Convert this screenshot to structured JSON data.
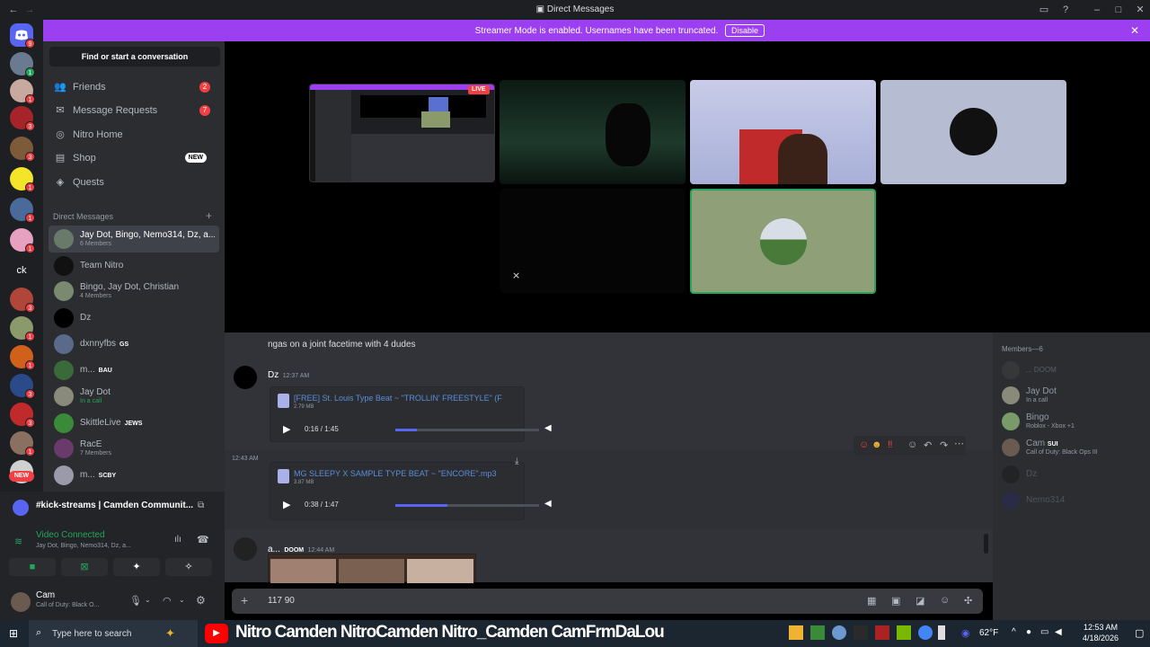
{
  "titlebar": {
    "title": "Direct Messages"
  },
  "banner": {
    "text": "Streamer Mode is enabled. Usernames have been truncated.",
    "button": "Disable"
  },
  "guild_badges": [
    "9",
    "1",
    "1",
    "3",
    "3",
    "1",
    "1",
    "1",
    "3",
    "1",
    "1",
    "3",
    "3",
    "1"
  ],
  "guild_text": {
    "ck": "ck",
    "new": "NEW"
  },
  "sidebar": {
    "search": "Find or start a conversation",
    "nav": [
      {
        "label": "Friends",
        "badge": "2"
      },
      {
        "label": "Message Requests",
        "badge": "7"
      },
      {
        "label": "Nitro Home",
        "badge": ""
      },
      {
        "label": "Shop",
        "badge": "NEW"
      },
      {
        "label": "Quests",
        "badge": ""
      }
    ],
    "dm_header": "Direct Messages",
    "dms": [
      {
        "name": "Jay Dot, Bingo, Nemo314, Dz, a...",
        "sub": "6 Members",
        "tag": ""
      },
      {
        "name": "Team Nitro",
        "sub": "",
        "tag": ""
      },
      {
        "name": "Bingo, Jay Dot, Christian",
        "sub": "4 Members",
        "tag": ""
      },
      {
        "name": "Dz",
        "sub": "",
        "tag": ""
      },
      {
        "name": "dxnnyfbs",
        "sub": "",
        "tag": "GS"
      },
      {
        "name": "m...",
        "sub": "",
        "tag": "BAU"
      },
      {
        "name": "Jay Dot",
        "sub": "In a call",
        "tag": ""
      },
      {
        "name": "SkittleLive",
        "sub": "",
        "tag": "JEWS"
      },
      {
        "name": "RacE",
        "sub": "7 Members",
        "tag": ""
      },
      {
        "name": "m...",
        "sub": "",
        "tag": "SCBY"
      }
    ]
  },
  "voice": {
    "channel": "#kick-streams | Camden Communit...",
    "status": "Video Connected",
    "members": "Jay Dot, Bingo, Nemo314, Dz, a..."
  },
  "user": {
    "name": "Cam",
    "activity": "Call of Duty: Black O..."
  },
  "stage": {
    "live": "LIVE"
  },
  "chat": {
    "partial_msg": "ngas on a joint facetime with 4 dudes",
    "msg1": {
      "author": "Dz",
      "time": "12:37 AM",
      "file": "[FREE] St. Louis Type Beat ~ \"TROLLIN' FREESTYLE\" (F",
      "size": "2.79 MB",
      "progress": "0:16 / 1:45",
      "fraction": 0.15
    },
    "msg2": {
      "time": "12:43 AM",
      "file": "MG SLEEPY X SAMPLE TYPE BEAT ~ \"ENCORE\".mp3",
      "size": "3.87 MB",
      "progress": "0:38 / 1:47",
      "fraction": 0.36
    },
    "msg3": {
      "author": "a...",
      "tag": "DOOM",
      "time": "12:44 AM"
    },
    "composer_text": "117 90"
  },
  "members": {
    "header": "Members—6",
    "list": [
      {
        "name": "...",
        "sub": "",
        "tag": "DOOM"
      },
      {
        "name": "Jay Dot",
        "sub": "In a call",
        "tag": ""
      },
      {
        "name": "Bingo",
        "sub": "Roblox - Xbox +1",
        "tag": ""
      },
      {
        "name": "Cam",
        "sub": "Call of Duty: Black Ops III",
        "tag": "SUI"
      },
      {
        "name": "Dz",
        "sub": "",
        "tag": ""
      },
      {
        "name": "Nemo314",
        "sub": "",
        "tag": ""
      }
    ]
  },
  "taskbar": {
    "search": "Type here to search",
    "banner_text": "Nitro Camden  NitroCamden  Nitro_Camden  CamFrmDaLou",
    "weather": "62°F",
    "time": "12:53 AM",
    "date": "4/18/2026"
  },
  "colors": {
    "accent": "#9b3ff0",
    "discord": "#5865f2",
    "red": "#f23f43",
    "green": "#23a55a"
  }
}
